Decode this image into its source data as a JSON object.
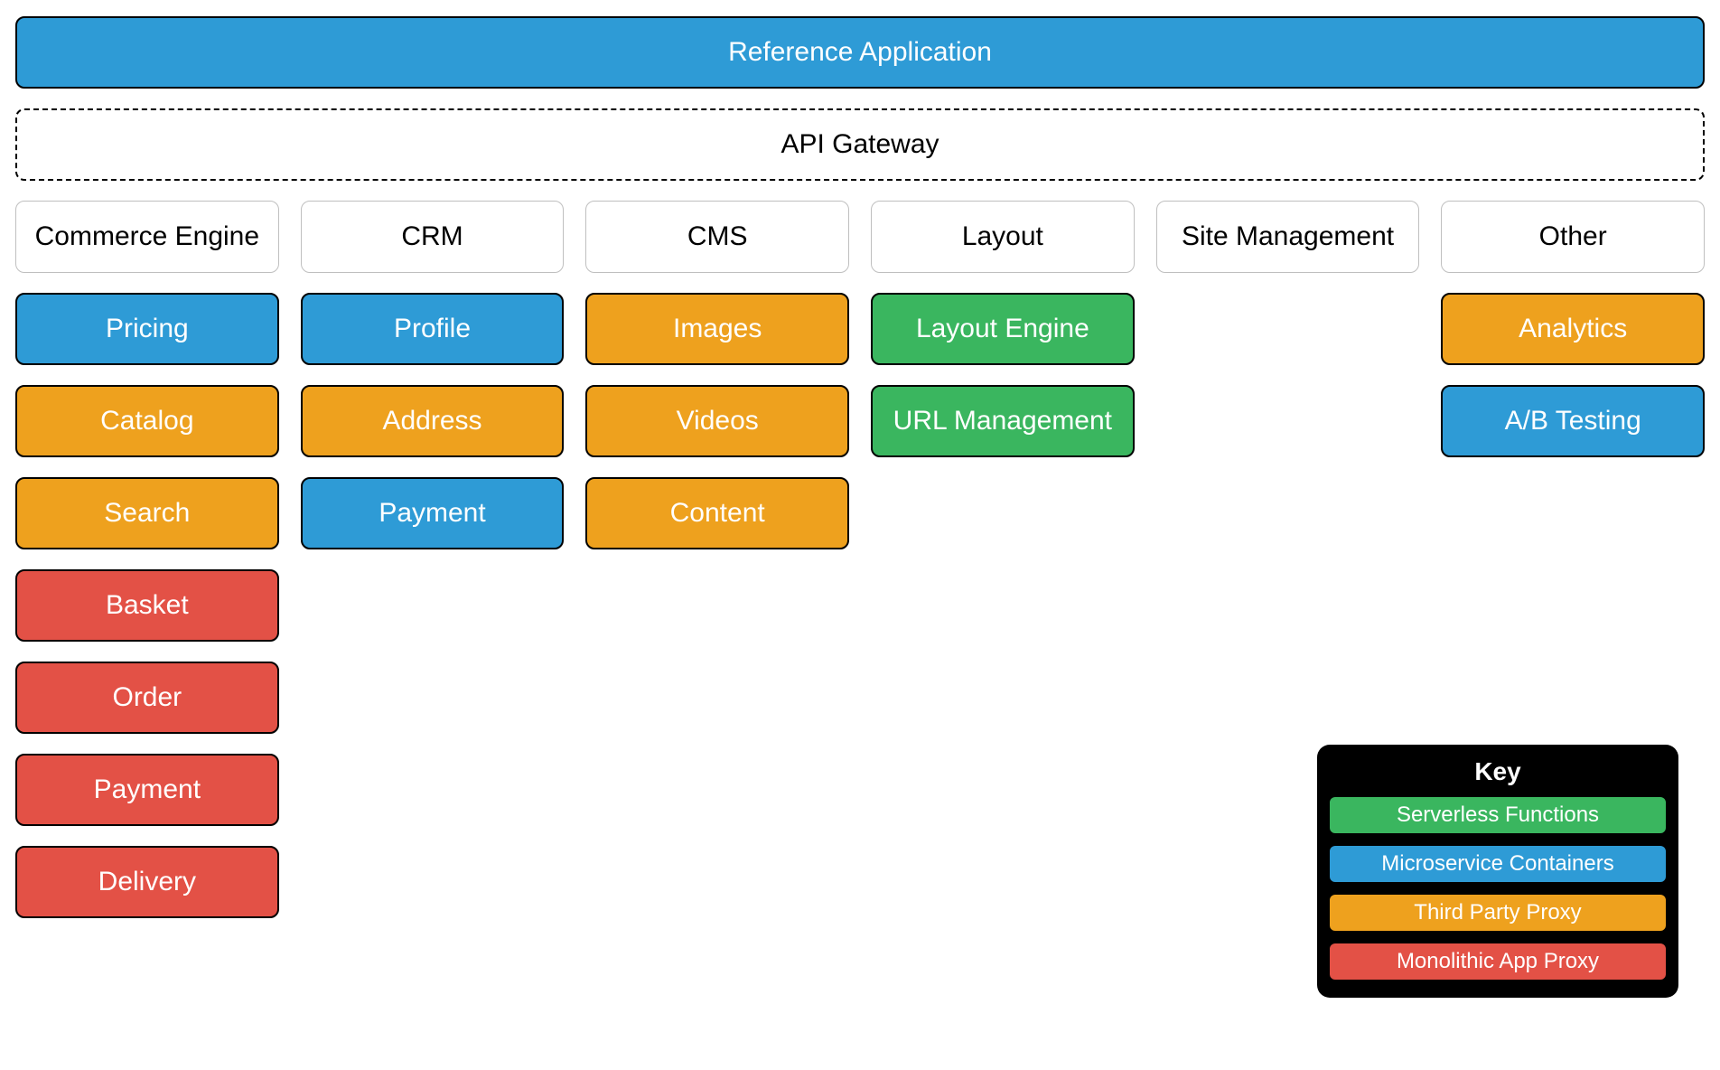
{
  "banner": {
    "title": "Reference Application",
    "gateway": "API Gateway"
  },
  "colors": {
    "blue": "#2e9bd6",
    "orange": "#eea11e",
    "red": "#e35146",
    "green": "#3ab65f"
  },
  "columns": [
    {
      "header": "Commerce Engine",
      "items": [
        {
          "label": "Pricing",
          "type": "blue"
        },
        {
          "label": "Catalog",
          "type": "orange"
        },
        {
          "label": "Search",
          "type": "orange"
        },
        {
          "label": "Basket",
          "type": "red"
        },
        {
          "label": "Order",
          "type": "red"
        },
        {
          "label": "Payment",
          "type": "red"
        },
        {
          "label": "Delivery",
          "type": "red"
        }
      ]
    },
    {
      "header": "CRM",
      "items": [
        {
          "label": "Profile",
          "type": "blue"
        },
        {
          "label": "Address",
          "type": "orange"
        },
        {
          "label": "Payment",
          "type": "blue"
        }
      ]
    },
    {
      "header": "CMS",
      "items": [
        {
          "label": "Images",
          "type": "orange"
        },
        {
          "label": "Videos",
          "type": "orange"
        },
        {
          "label": "Content",
          "type": "orange"
        }
      ]
    },
    {
      "header": "Layout",
      "items": [
        {
          "label": "Layout Engine",
          "type": "green"
        },
        {
          "label": "URL Management",
          "type": "green"
        }
      ]
    },
    {
      "header": "Site Management",
      "items": []
    },
    {
      "header": "Other",
      "items": [
        {
          "label": "Analytics",
          "type": "orange"
        },
        {
          "label": "A/B Testing",
          "type": "blue"
        }
      ]
    }
  ],
  "legend": {
    "title": "Key",
    "items": [
      {
        "label": "Serverless Functions",
        "type": "green"
      },
      {
        "label": "Microservice Containers",
        "type": "blue"
      },
      {
        "label": "Third Party Proxy",
        "type": "orange"
      },
      {
        "label": "Monolithic App Proxy",
        "type": "red"
      }
    ]
  }
}
